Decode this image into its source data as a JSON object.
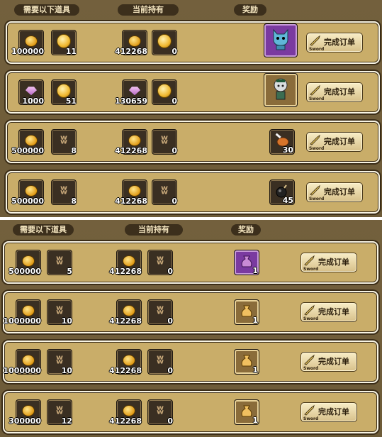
{
  "headers": {
    "need": "需要以下道具",
    "have": "当前持有",
    "reward": "奖励"
  },
  "button": {
    "label": "完成订单",
    "sub": "Sword"
  },
  "rows_top": [
    {
      "need": [
        {
          "icon": "gold-coin-icon",
          "num": "100000"
        },
        {
          "icon": "token-icon",
          "num": "11"
        }
      ],
      "have": [
        {
          "icon": "gold-coin-icon",
          "num": "412268"
        },
        {
          "icon": "token-icon",
          "num": "0"
        }
      ],
      "reward": {
        "icon": "blue-cat-pet-icon",
        "num": "",
        "style": "purple-big"
      }
    },
    {
      "need": [
        {
          "icon": "pink-gem-icon",
          "num": "1000"
        },
        {
          "icon": "token-icon",
          "num": "51"
        }
      ],
      "have": [
        {
          "icon": "pink-gem-icon",
          "num": "130659"
        },
        {
          "icon": "token-icon",
          "num": "0"
        }
      ],
      "reward": {
        "icon": "girl-character-icon",
        "num": "",
        "style": "gold-big"
      }
    },
    {
      "need": [
        {
          "icon": "gold-coin-icon",
          "num": "500000"
        },
        {
          "icon": "antler-icon",
          "num": "8"
        }
      ],
      "have": [
        {
          "icon": "gold-coin-icon",
          "num": "412268"
        },
        {
          "icon": "antler-icon",
          "num": "0"
        }
      ],
      "reward": {
        "icon": "meat-icon",
        "num": "30",
        "style": "dark"
      }
    },
    {
      "need": [
        {
          "icon": "gold-coin-icon",
          "num": "500000"
        },
        {
          "icon": "antler-icon",
          "num": "8"
        }
      ],
      "have": [
        {
          "icon": "gold-coin-icon",
          "num": "412268"
        },
        {
          "icon": "antler-icon",
          "num": "0"
        }
      ],
      "reward": {
        "icon": "bomb-icon",
        "num": "45",
        "style": "dark"
      }
    }
  ],
  "rows_bottom": [
    {
      "need": [
        {
          "icon": "gold-coin-icon",
          "num": "500000"
        },
        {
          "icon": "antler-icon",
          "num": "5"
        }
      ],
      "have": [
        {
          "icon": "gold-coin-icon",
          "num": "412268"
        },
        {
          "icon": "antler-icon",
          "num": "0"
        }
      ],
      "reward": {
        "icon": "purple-bag-icon",
        "num": "1",
        "style": "purple"
      }
    },
    {
      "need": [
        {
          "icon": "gold-coin-icon",
          "num": "1000000"
        },
        {
          "icon": "antler-icon",
          "num": "10"
        }
      ],
      "have": [
        {
          "icon": "gold-coin-icon",
          "num": "412268"
        },
        {
          "icon": "antler-icon",
          "num": "0"
        }
      ],
      "reward": {
        "icon": "gold-bag-icon",
        "num": "1",
        "style": "gold"
      }
    },
    {
      "need": [
        {
          "icon": "gold-coin-icon",
          "num": "1000000"
        },
        {
          "icon": "antler-icon",
          "num": "10"
        }
      ],
      "have": [
        {
          "icon": "gold-coin-icon",
          "num": "412268"
        },
        {
          "icon": "antler-icon",
          "num": "0"
        }
      ],
      "reward": {
        "icon": "gold-bag-icon",
        "num": "1",
        "style": "gold"
      }
    },
    {
      "need": [
        {
          "icon": "gold-coin-icon",
          "num": "300000"
        },
        {
          "icon": "antler-icon",
          "num": "12"
        }
      ],
      "have": [
        {
          "icon": "gold-coin-icon",
          "num": "412268"
        },
        {
          "icon": "antler-icon",
          "num": "0"
        }
      ],
      "reward": {
        "icon": "gold-bag-icon",
        "num": "1",
        "style": "gold"
      }
    }
  ]
}
